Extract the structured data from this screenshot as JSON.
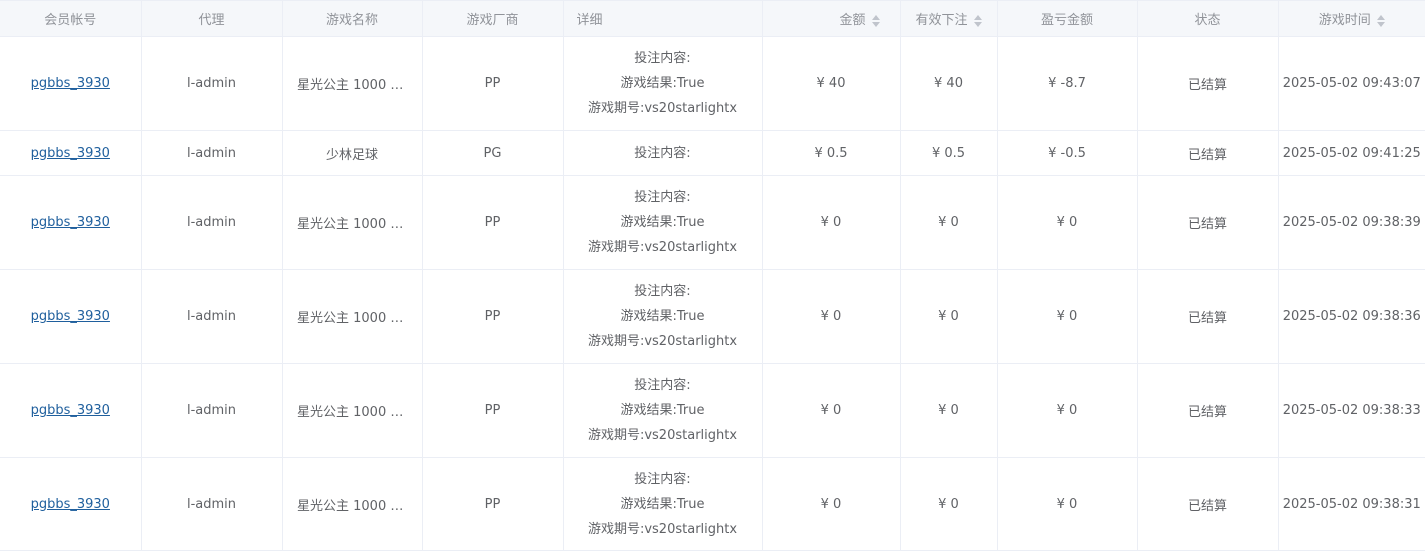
{
  "table": {
    "columns": {
      "member": "会员帐号",
      "agent": "代理",
      "game_name": "游戏名称",
      "vendor": "游戏厂商",
      "detail": "详细",
      "amount": "金额",
      "valid_bet": "有效下注",
      "profit": "盈亏金额",
      "status": "状态",
      "game_time": "游戏时间"
    },
    "detail_labels": {
      "bet_content": "投注内容:",
      "game_result": "游戏结果:",
      "round_id": "游戏期号:"
    },
    "rows": [
      {
        "member": "pgbbs_3930",
        "agent": "l-admin",
        "game_name": "星光公主 1000 (...",
        "vendor": "PP",
        "bet_content": "",
        "game_result": "True",
        "round_id": "vs20starlightx",
        "amount": "¥ 40",
        "valid_bet": "¥ 40",
        "profit": "¥ -8.7",
        "status": "已结算",
        "game_time": "2025-05-02 09:43:07"
      },
      {
        "member": "pgbbs_3930",
        "agent": "l-admin",
        "game_name": "少林足球",
        "vendor": "PG",
        "bet_content": "",
        "amount": "¥ 0.5",
        "valid_bet": "¥ 0.5",
        "profit": "¥ -0.5",
        "status": "已结算",
        "game_time": "2025-05-02 09:41:25"
      },
      {
        "member": "pgbbs_3930",
        "agent": "l-admin",
        "game_name": "星光公主 1000 (...",
        "vendor": "PP",
        "bet_content": "",
        "game_result": "True",
        "round_id": "vs20starlightx",
        "amount": "¥ 0",
        "valid_bet": "¥ 0",
        "profit": "¥ 0",
        "status": "已结算",
        "game_time": "2025-05-02 09:38:39"
      },
      {
        "member": "pgbbs_3930",
        "agent": "l-admin",
        "game_name": "星光公主 1000 (...",
        "vendor": "PP",
        "bet_content": "",
        "game_result": "True",
        "round_id": "vs20starlightx",
        "amount": "¥ 0",
        "valid_bet": "¥ 0",
        "profit": "¥ 0",
        "status": "已结算",
        "game_time": "2025-05-02 09:38:36"
      },
      {
        "member": "pgbbs_3930",
        "agent": "l-admin",
        "game_name": "星光公主 1000 (...",
        "vendor": "PP",
        "bet_content": "",
        "game_result": "True",
        "round_id": "vs20starlightx",
        "amount": "¥ 0",
        "valid_bet": "¥ 0",
        "profit": "¥ 0",
        "status": "已结算",
        "game_time": "2025-05-02 09:38:33"
      },
      {
        "member": "pgbbs_3930",
        "agent": "l-admin",
        "game_name": "星光公主 1000 (...",
        "vendor": "PP",
        "bet_content": "",
        "game_result": "True",
        "round_id": "vs20starlightx",
        "amount": "¥ 0",
        "valid_bet": "¥ 0",
        "profit": "¥ 0",
        "status": "已结算",
        "game_time": "2025-05-02 09:38:31"
      }
    ]
  },
  "icons": {
    "sort": "sort-caret-icon"
  },
  "colors": {
    "header_bg": "#f5f7fa",
    "header_text": "#909399",
    "body_text": "#606266",
    "link": "#1f5f9d",
    "border": "#ebeef5",
    "sort_caret": "#c0c4cc"
  }
}
